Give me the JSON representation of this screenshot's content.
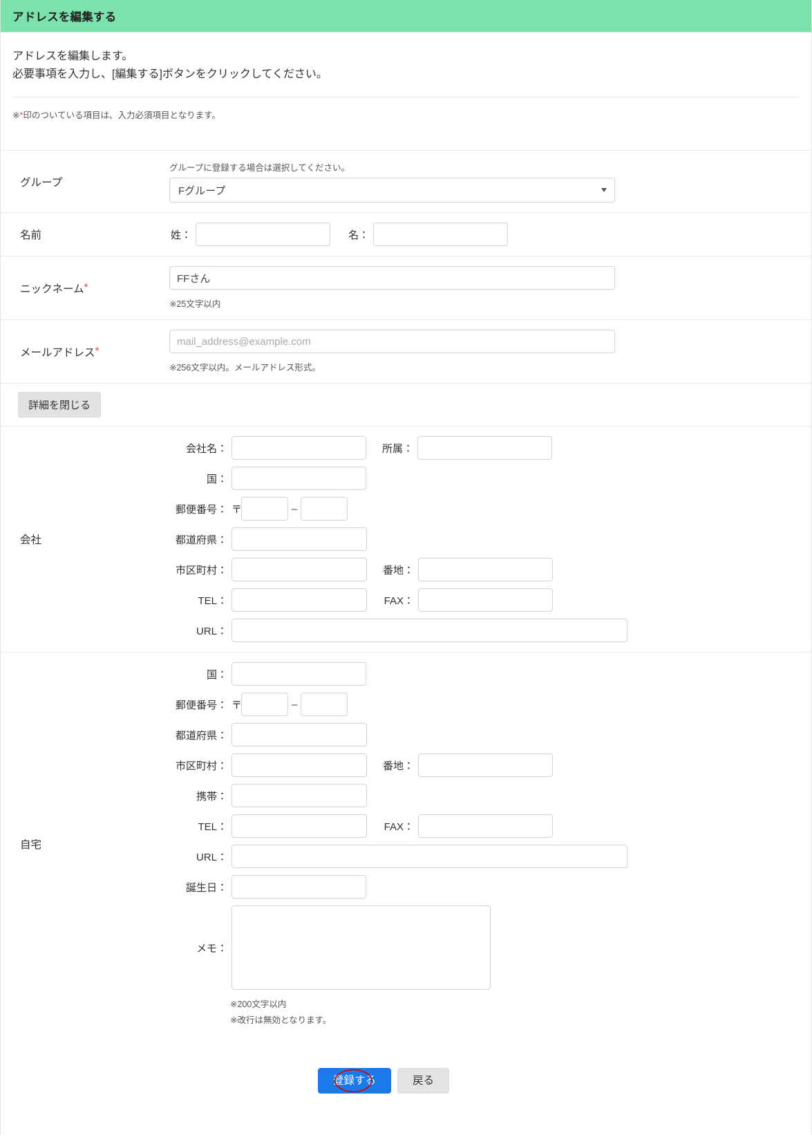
{
  "header": {
    "title": "アドレスを編集する",
    "bg_color": "#7ce2ab"
  },
  "intro": {
    "line1": "アドレスを編集します。",
    "line2": "必要事項を入力し、[編集する]ボタンをクリックしてください。",
    "required_note_prefix": "※",
    "required_note_star": "*",
    "required_note_suffix": "印のついている項目は、入力必須項目となります。"
  },
  "form": {
    "group": {
      "label": "グループ",
      "helper": "グループに登録する場合は選択してください。",
      "selected": "Fグループ",
      "caret_icon": "chevron-down-icon"
    },
    "name": {
      "label": "名前",
      "last_label": "姓：",
      "last_value": "",
      "first_label": "名：",
      "first_value": ""
    },
    "nickname": {
      "label": "ニックネーム",
      "required_mark": "*",
      "value": "FFさん",
      "helper": "※25文字以内"
    },
    "email": {
      "label": "メールアドレス",
      "required_mark": "*",
      "value": "",
      "placeholder": "mail_address@example.com",
      "helper": "※256文字以内。メールアドレス形式。"
    },
    "detail_toggle": {
      "label": "詳細を閉じる"
    },
    "company": {
      "label": "会社",
      "fields": {
        "company_name_label": "会社名：",
        "company_name_value": "",
        "department_label": "所属：",
        "department_value": "",
        "country_label": "国：",
        "country_value": "",
        "zip_label": "郵便番号：",
        "zip_mark": "〒",
        "zip_first_value": "",
        "zip_sep": "–",
        "zip_second_value": "",
        "prefecture_label": "都道府県：",
        "prefecture_value": "",
        "city_label": "市区町村：",
        "city_value": "",
        "street_label": "番地：",
        "street_value": "",
        "tel_label": "TEL：",
        "tel_value": "",
        "fax_label": "FAX：",
        "fax_value": "",
        "url_label": "URL：",
        "url_value": ""
      }
    },
    "home": {
      "label": "自宅",
      "fields": {
        "country_label": "国：",
        "country_value": "",
        "zip_label": "郵便番号：",
        "zip_mark": "〒",
        "zip_first_value": "",
        "zip_sep": "–",
        "zip_second_value": "",
        "prefecture_label": "都道府県：",
        "prefecture_value": "",
        "city_label": "市区町村：",
        "city_value": "",
        "street_label": "番地：",
        "street_value": "",
        "mobile_label": "携帯：",
        "mobile_value": "",
        "tel_label": "TEL：",
        "tel_value": "",
        "fax_label": "FAX：",
        "fax_value": "",
        "url_label": "URL：",
        "url_value": "",
        "birthday_label": "誕生日：",
        "birthday_value": "",
        "memo_label": "メモ：",
        "memo_value": "",
        "memo_helper1": "※200文字以内",
        "memo_helper2": "※改行は無効となります。"
      }
    }
  },
  "actions": {
    "submit_label": "登録する",
    "submit_color": "#1a7aea",
    "back_label": "戻る",
    "annotation_color": "#d40000"
  }
}
